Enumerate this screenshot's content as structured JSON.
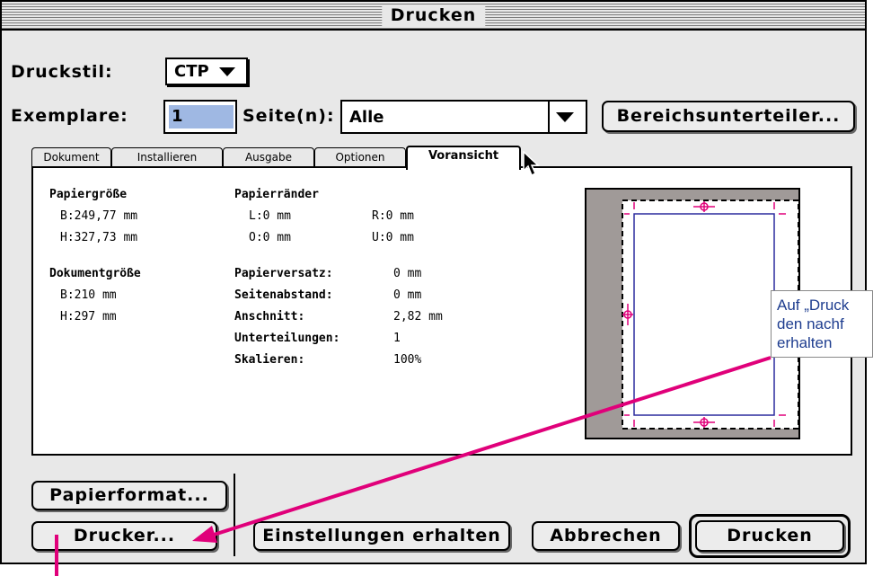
{
  "dialog": {
    "title": "Drucken",
    "druckstil_label": "Druckstil:",
    "druckstil_value": "CTP",
    "exemplare_label": "Exemplare:",
    "exemplare_value": "1",
    "seiten_label": "Seite(n):",
    "seiten_value": "Alle",
    "bereich_button": "Bereichsunterteiler..."
  },
  "tabs": [
    "Dokument",
    "Installieren",
    "Ausgabe",
    "Optionen",
    "Voransicht"
  ],
  "panel": {
    "papiergroesse": {
      "title": "Papiergröße",
      "b": "B:249,77 mm",
      "h": "H:327,73 mm"
    },
    "papierraender": {
      "title": "Papierränder",
      "l": "L:0 mm",
      "r": "R:0 mm",
      "o": "O:0 mm",
      "u": "U:0 mm"
    },
    "dokumentgroesse": {
      "title": "Dokumentgröße",
      "b": "B:210 mm",
      "h": "H:297 mm"
    },
    "settings": [
      {
        "label": "Papierversatz:",
        "value": "0 mm"
      },
      {
        "label": "Seitenabstand:",
        "value": "0 mm"
      },
      {
        "label": "Anschnitt:",
        "value": "2,82 mm"
      },
      {
        "label": "Unterteilungen:",
        "value": "1"
      },
      {
        "label": "Skalieren:",
        "value": "100%"
      }
    ]
  },
  "buttons": {
    "papierformat": "Papierformat...",
    "drucker": "Drucker...",
    "einstellungen": "Einstellungen erhalten",
    "abbrechen": "Abbrechen",
    "drucken": "Drucken"
  },
  "callout": {
    "line1": "Auf „Druck",
    "line2": "den nachf",
    "line3": "erhalten"
  },
  "colors": {
    "highlight": "#9fb8e3",
    "preview_gray": "#a09a98",
    "magenta": "#e0007a",
    "page_blue": "#2b2b9e",
    "callout_text": "#1e3d8f"
  },
  "icons": [
    "triangle-down-icon",
    "arrow-cursor-icon",
    "registration-mark-icon"
  ]
}
